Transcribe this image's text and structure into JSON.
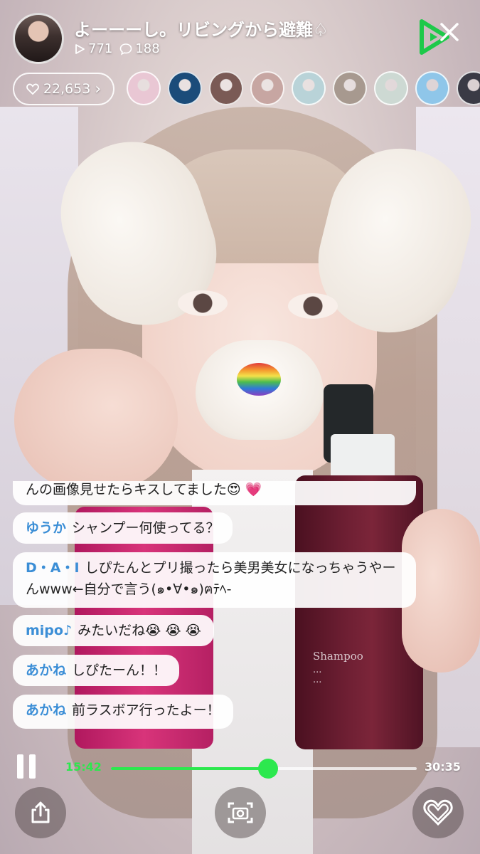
{
  "header": {
    "title": "よーーーし。リビングから避難♤",
    "views": "771",
    "comments": "188",
    "likes": "22,653",
    "likes_chevron": "›"
  },
  "viewer_avatars": [
    {
      "color": "#e9c7d4"
    },
    {
      "color": "#1b4c7a"
    },
    {
      "color": "#7a5a55"
    },
    {
      "color": "#c7a6a2"
    },
    {
      "color": "#b9d3d8"
    },
    {
      "color": "#a7998f"
    },
    {
      "color": "#cdd9d3"
    },
    {
      "color": "#8fc6e9"
    },
    {
      "color": "#3a3a45"
    }
  ],
  "bottle_label": {
    "line1": "Shampoo",
    "line2": "...",
    "line3": "..."
  },
  "comments": [
    {
      "name": "",
      "text": "んの画像見せたらキスしてました😍 💗"
    },
    {
      "name": "ゆうか",
      "text": "シャンプー何使ってる？"
    },
    {
      "name": "D・A・I",
      "text": "しぴたんとプリ撮ったら美男美女になっちゃうやーんwww←自分で言う(๑•∀•๑)ฅﾃﾍ-"
    },
    {
      "name": "mipo♪",
      "text": "みたいだね😭 😭 😭"
    },
    {
      "name": "あかね",
      "text": "しぴたーん！！"
    },
    {
      "name": "あかね",
      "text": "前ラスボア行ったよー！"
    }
  ],
  "playback": {
    "current_time": "15:42",
    "total_time": "30:35",
    "progress": 0.514
  },
  "colors": {
    "accent_green": "#2ce84e",
    "comment_name": "#3b8ed6"
  },
  "icons": {
    "pause": "pause-icon",
    "share": "share-icon",
    "capture": "camera-capture-icon",
    "heart": "heart-icon",
    "close": "close-icon"
  }
}
